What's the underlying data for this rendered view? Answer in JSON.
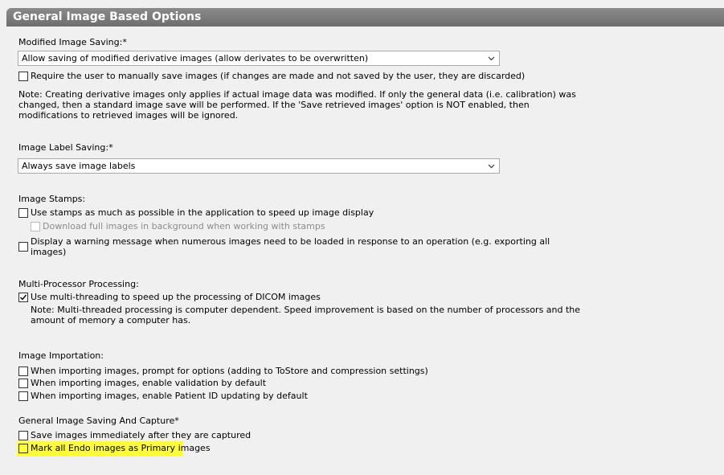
{
  "header": {
    "title": "General Image Based Options"
  },
  "modified": {
    "label": "Modified Image Saving:*",
    "select_value": "Allow saving of modified derivative images (allow derivates to be overwritten)",
    "checkbox": "Require the user to manually save images (if changes are made and not saved by the user, they are discarded)",
    "note_lines": [
      "Note: Creating derivative images only applies if actual image data was modified.  If only the general data (i.e. calibration) was",
      "changed, then a standard image save will be performed.  If the 'Save retrieved images' option is NOT enabled, then",
      "modifications to retrieved images will be ignored."
    ]
  },
  "label_saving": {
    "label": "Image Label Saving:*",
    "select_value": "Always save image labels"
  },
  "stamps": {
    "label": "Image Stamps:",
    "use_stamps": "Use stamps as much as possible in the application to speed up image display",
    "download_full": "Download full images in background when working with stamps",
    "warning_line1": "Display a warning message when numerous images need to be loaded in response to an operation (e.g. exporting all",
    "warning_line2": "images)"
  },
  "multi": {
    "label": "Multi-Processor Processing:",
    "checkbox": "Use multi-threading to speed up the processing of DICOM images",
    "checked": true,
    "note_line1": "Note: Multi-threaded processing is computer dependent.  Speed improvement is based on the number of processors and the",
    "note_line2": "amount of memory a computer has."
  },
  "importation": {
    "label": "Image Importation:",
    "items": [
      "When importing images, prompt for options (adding to ToStore and compression settings)",
      "When importing images, enable validation by default",
      "When importing images, enable Patient ID updating by default"
    ]
  },
  "capture": {
    "label": "General Image Saving And Capture*",
    "items": [
      "Save images immediately after they are captured",
      "Mark all Endo images as Primary images"
    ],
    "highlight_color": "#ffff3c"
  }
}
